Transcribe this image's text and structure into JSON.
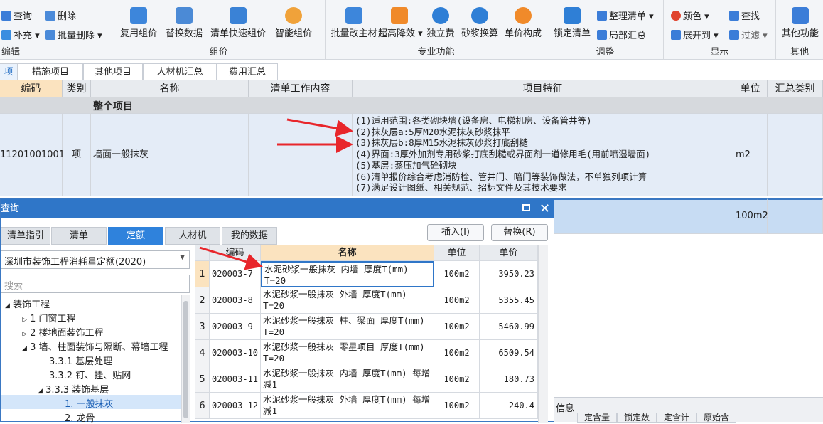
{
  "ribbon": {
    "groups": {
      "edit": "编辑",
      "pricing": "组价",
      "professional": "专业功能",
      "adjust": "调整",
      "display": "显示",
      "other": "其他"
    },
    "query": "查询",
    "delete": "删除",
    "supplement": "补充",
    "batch_delete": "批量删除",
    "reuse_price": "复用组价",
    "replace_data": "替换数据",
    "bill_quick_price": "清单快速组价",
    "smart_price": "智能组价",
    "batch_main_material": "批量改主材",
    "super_high_reduce": "超高降效",
    "independent_fee": "独立费",
    "mortar_convert": "砂浆换算",
    "unit_price_compose": "单价构成",
    "lock_bill": "锁定清单",
    "organize_bill": "整理清单",
    "partial_summary": "局部汇总",
    "color": "颜色",
    "expand_to": "展开到",
    "find": "查找",
    "filter": "过滤",
    "other_functions": "其他功能"
  },
  "tabs": [
    "项",
    "措施项目",
    "其他项目",
    "人材机汇总",
    "费用汇总"
  ],
  "grid": {
    "headers": [
      "编码",
      "类别",
      "名称",
      "清单工作内容",
      "项目特征",
      "单位",
      "汇总类别"
    ],
    "section_title": "整个项目",
    "row": {
      "code": "11201001001",
      "type": "项",
      "name": "墙面一般抹灰",
      "features": [
        "(1)适用范围:各类砌块墙(设备房、电梯机房、设备管井等)",
        "(2)抹灰层a:5厚M20水泥抹灰砂浆抹平",
        "(3)抹灰层b:8厚M15水泥抹灰砂浆打底刮糙",
        "(4)界面:3厚外加剂专用砂浆打底刮糙或界面剂一道修用毛(用前喷湿墙面)",
        "(5)基层:蒸压加气砼砌块",
        "(6)清单报价综合考虑消防栓、管井门、暗门等装饰做法，不单独列项计算",
        "(7)满足设计图纸、相关规范、招标文件及其技术要求"
      ],
      "unit": "m2"
    },
    "row2_unit": "100m2"
  },
  "dialog": {
    "title": "查询",
    "tabs": [
      "清单指引",
      "清单",
      "定额",
      "人材机",
      "我的数据"
    ],
    "insert": "插入(I)",
    "replace": "替换(R)",
    "library": "深圳市装饰工程消耗量定额(2020)",
    "search_placeholder": "搜索",
    "tree": {
      "root": "装饰工程",
      "n1": "1 门窗工程",
      "n2": "2 楼地面装饰工程",
      "n3": "3 墙、柱面装饰与隔断、幕墙工程",
      "n331": "3.3.1 基层处理",
      "n332": "3.3.2 钉、挂、贴网",
      "n333": "3.3.3 装饰基层",
      "leaf1": "1. 一般抹灰",
      "leaf2": "2. 龙骨"
    },
    "table_headers": [
      "编码",
      "名称",
      "单位",
      "单价"
    ],
    "rows": [
      {
        "no": "1",
        "code": "020003-7",
        "name": "水泥砂浆一般抹灰 内墙 厚度T(mm) T=20",
        "unit": "100m2",
        "price": "3950.23"
      },
      {
        "no": "2",
        "code": "020003-8",
        "name": "水泥砂浆一般抹灰 外墙 厚度T(mm) T=20",
        "unit": "100m2",
        "price": "5355.45"
      },
      {
        "no": "3",
        "code": "020003-9",
        "name": "水泥砂浆一般抹灰 柱、梁面 厚度T(mm) T=20",
        "unit": "100m2",
        "price": "5460.99"
      },
      {
        "no": "4",
        "code": "020003-10",
        "name": "水泥砂浆一般抹灰 零星项目 厚度T(mm) T=20",
        "unit": "100m2",
        "price": "6509.54"
      },
      {
        "no": "5",
        "code": "020003-11",
        "name": "水泥砂浆一般抹灰 内墙 厚度T(mm) 每增减1",
        "unit": "100m2",
        "price": "180.73"
      },
      {
        "no": "6",
        "code": "020003-12",
        "name": "水泥砂浆一般抹灰 外墙 厚度T(mm) 每增减1",
        "unit": "100m2",
        "price": "240.4"
      }
    ]
  },
  "bottom": {
    "info": "信息",
    "tabs": [
      "定含量",
      "锁定数",
      "定含计",
      "原始含"
    ]
  }
}
